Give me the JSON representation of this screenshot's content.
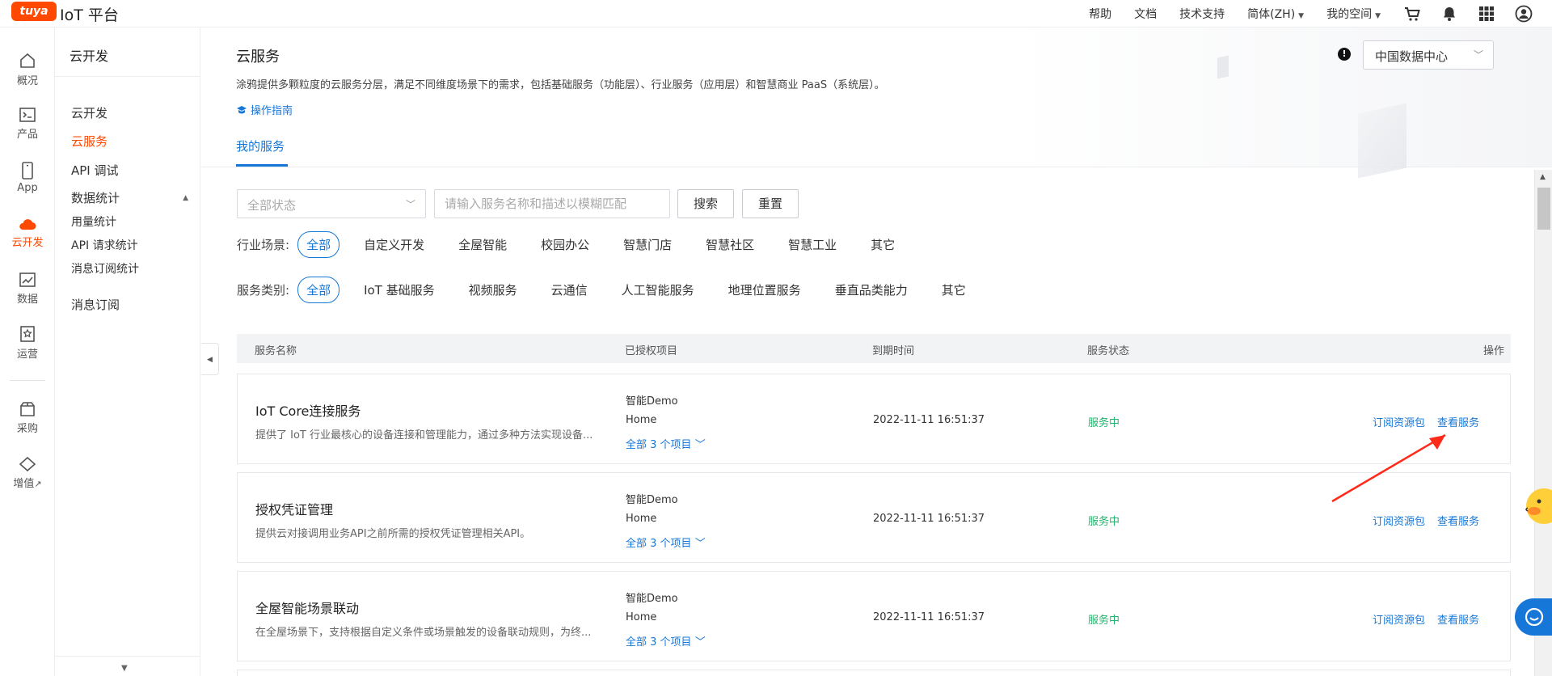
{
  "header": {
    "logo_badge": "tuya",
    "logo_text": "IoT 平台",
    "nav": [
      {
        "label": "帮助"
      },
      {
        "label": "文档"
      },
      {
        "label": "技术支持"
      },
      {
        "label": "简体(ZH)"
      },
      {
        "label": "我的空间"
      }
    ],
    "icons": [
      "cart-icon",
      "bell-icon",
      "apps-grid-icon",
      "user-icon"
    ]
  },
  "rail": {
    "items": [
      {
        "label": "概况",
        "icon": "home-icon"
      },
      {
        "label": "产品",
        "icon": "terminal-icon"
      },
      {
        "label": "App",
        "icon": "phone-icon"
      },
      {
        "label": "云开发",
        "icon": "cloud-icon",
        "active": true
      },
      {
        "label": "数据",
        "icon": "chart-icon"
      },
      {
        "label": "运营",
        "icon": "badge-icon"
      },
      {
        "label": "采购",
        "icon": "box-icon"
      },
      {
        "label": "增值",
        "icon": "diamond-icon"
      }
    ],
    "external_mark": "↗"
  },
  "sidebar": {
    "title": "云开发",
    "items": [
      {
        "label": "云开发"
      },
      {
        "label": "云服务",
        "active": true
      },
      {
        "label": "API 调试"
      },
      {
        "label": "数据统计"
      },
      {
        "label": "用量统计"
      },
      {
        "label": "API 请求统计"
      },
      {
        "label": "消息订阅统计"
      },
      {
        "label": "消息订阅"
      }
    ]
  },
  "page": {
    "title": "云服务",
    "description": "涂鸦提供多颗粒度的云服务分层，满足不同维度场景下的需求，包括基础服务（功能层）、行业服务（应用层）和智慧商业 PaaS（系统层）。",
    "guide_link": "操作指南",
    "tab": "我的服务",
    "region": "中国数据中心",
    "info_mark": "!"
  },
  "filters": {
    "status_placeholder": "全部状态",
    "search_placeholder": "请输入服务名称和描述以模糊匹配",
    "search_btn": "搜索",
    "reset_btn": "重置",
    "scene_label": "行业场景:",
    "scenes": [
      "全部",
      "自定义开发",
      "全屋智能",
      "校园办公",
      "智慧门店",
      "智慧社区",
      "智慧工业",
      "其它"
    ],
    "category_label": "服务类别:",
    "categories": [
      "全部",
      "IoT 基础服务",
      "视频服务",
      "云通信",
      "人工智能服务",
      "地理位置服务",
      "垂直品类能力",
      "其它"
    ]
  },
  "table": {
    "columns": [
      "服务名称",
      "已授权项目",
      "到期时间",
      "服务状态",
      "操作"
    ],
    "rows": [
      {
        "name": "IoT Core连接服务",
        "desc": "提供了 IoT 行业最核心的设备连接和管理能力，通过多种方法实现设备...",
        "projects": [
          "智能Demo",
          "Home"
        ],
        "more": "全部 3 个项目",
        "expire": "2022-11-11 16:51:37",
        "status": "服务中",
        "action1": "订阅资源包",
        "action2": "查看服务"
      },
      {
        "name": "授权凭证管理",
        "desc": "提供云对接调用业务API之前所需的授权凭证管理相关API。",
        "projects": [
          "智能Demo",
          "Home"
        ],
        "more": "全部 3 个项目",
        "expire": "2022-11-11 16:51:37",
        "status": "服务中",
        "action1": "订阅资源包",
        "action2": "查看服务"
      },
      {
        "name": "全屋智能场景联动",
        "desc": "在全屋场景下，支持根据自定义条件或场景触发的设备联动规则，为终...",
        "projects": [
          "智能Demo",
          "Home"
        ],
        "more": "全部 3 个项目",
        "expire": "2022-11-11 16:51:37",
        "status": "服务中",
        "action1": "订阅资源包",
        "action2": "查看服务"
      }
    ]
  },
  "colors": {
    "brand": "#ff4800",
    "link": "#1677d8",
    "status_ok": "#21b26b",
    "annotation_arrow": "#ff2a1a"
  }
}
